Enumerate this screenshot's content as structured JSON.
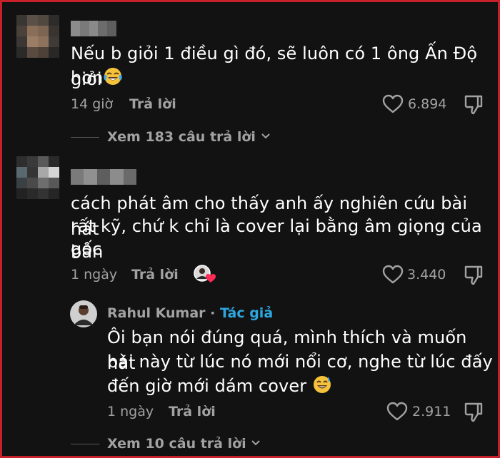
{
  "comments": [
    {
      "text_line1": "Nếu b giỏi 1 điều gì đó, sẽ luôn có 1 ông Ấn Độ giỏi",
      "text_line2": "hơn",
      "time": "14 giờ",
      "reply_label": "Trả lời",
      "likes": "6.894",
      "view_replies": "Xem 183 câu trả lời",
      "emoji": "laughing-tears-emoji"
    },
    {
      "text_line1": "cách phát âm cho thấy anh ấy nghiên cứu bài hát",
      "text_line2": "rất kỹ, chứ k chỉ là cover lại bằng âm giọng của bản",
      "text_line3": "gốc",
      "time": "1 ngày",
      "reply_label": "Trả lời",
      "likes": "3.440"
    }
  ],
  "author_reply": {
    "name": "Rahul Kumar",
    "separator": " · ",
    "badge": "Tác giả",
    "text_line1": "Ôi bạn nói đúng quá, mình thích và muốn hát",
    "text_line2": "bài này từ lúc nó mới nổi cơ, nghe từ lúc đấy",
    "text_line3": "đến giờ mới dám cover",
    "emoji": "sweat-smile-emoji",
    "time": "1 ngày",
    "reply_label": "Trả lời",
    "likes": "2.911",
    "view_replies": "Xem 10 câu trả lời"
  },
  "colors": {
    "background": "#121212",
    "border": "#c7202a",
    "text": "#ffffff",
    "muted": "#a2a2a2",
    "author_badge": "#2ea7e0"
  }
}
